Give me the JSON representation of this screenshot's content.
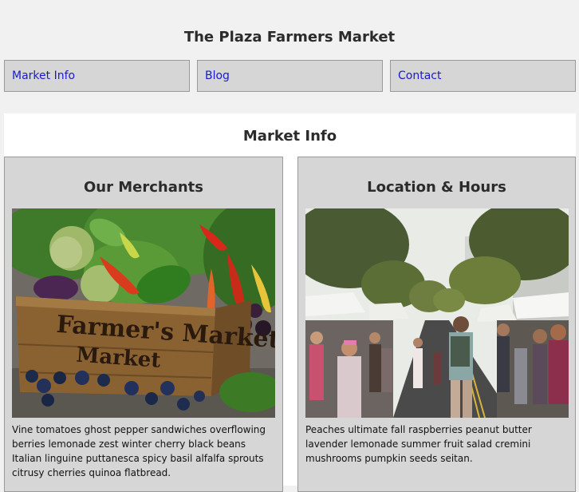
{
  "site": {
    "title": "The Plaza Farmers Market"
  },
  "nav": {
    "items": [
      {
        "label": "Market Info"
      },
      {
        "label": "Blog"
      },
      {
        "label": "Contact"
      }
    ]
  },
  "section": {
    "title": "Market Info",
    "cards": [
      {
        "title": "Our Merchants",
        "image_caption": "Farmer's Market",
        "text": "Vine tomatoes ghost pepper sandwiches overflowing berries lemonade zest winter cherry black beans Italian linguine puttanesca spicy basil alfalfa sprouts citrusy cherries quinoa flatbread."
      },
      {
        "title": "Location & Hours",
        "text": "Peaches ultimate fall raspberries peanut butter lavender lemonade summer fruit salad cremini mushrooms pumpkin seeds seitan."
      }
    ]
  }
}
